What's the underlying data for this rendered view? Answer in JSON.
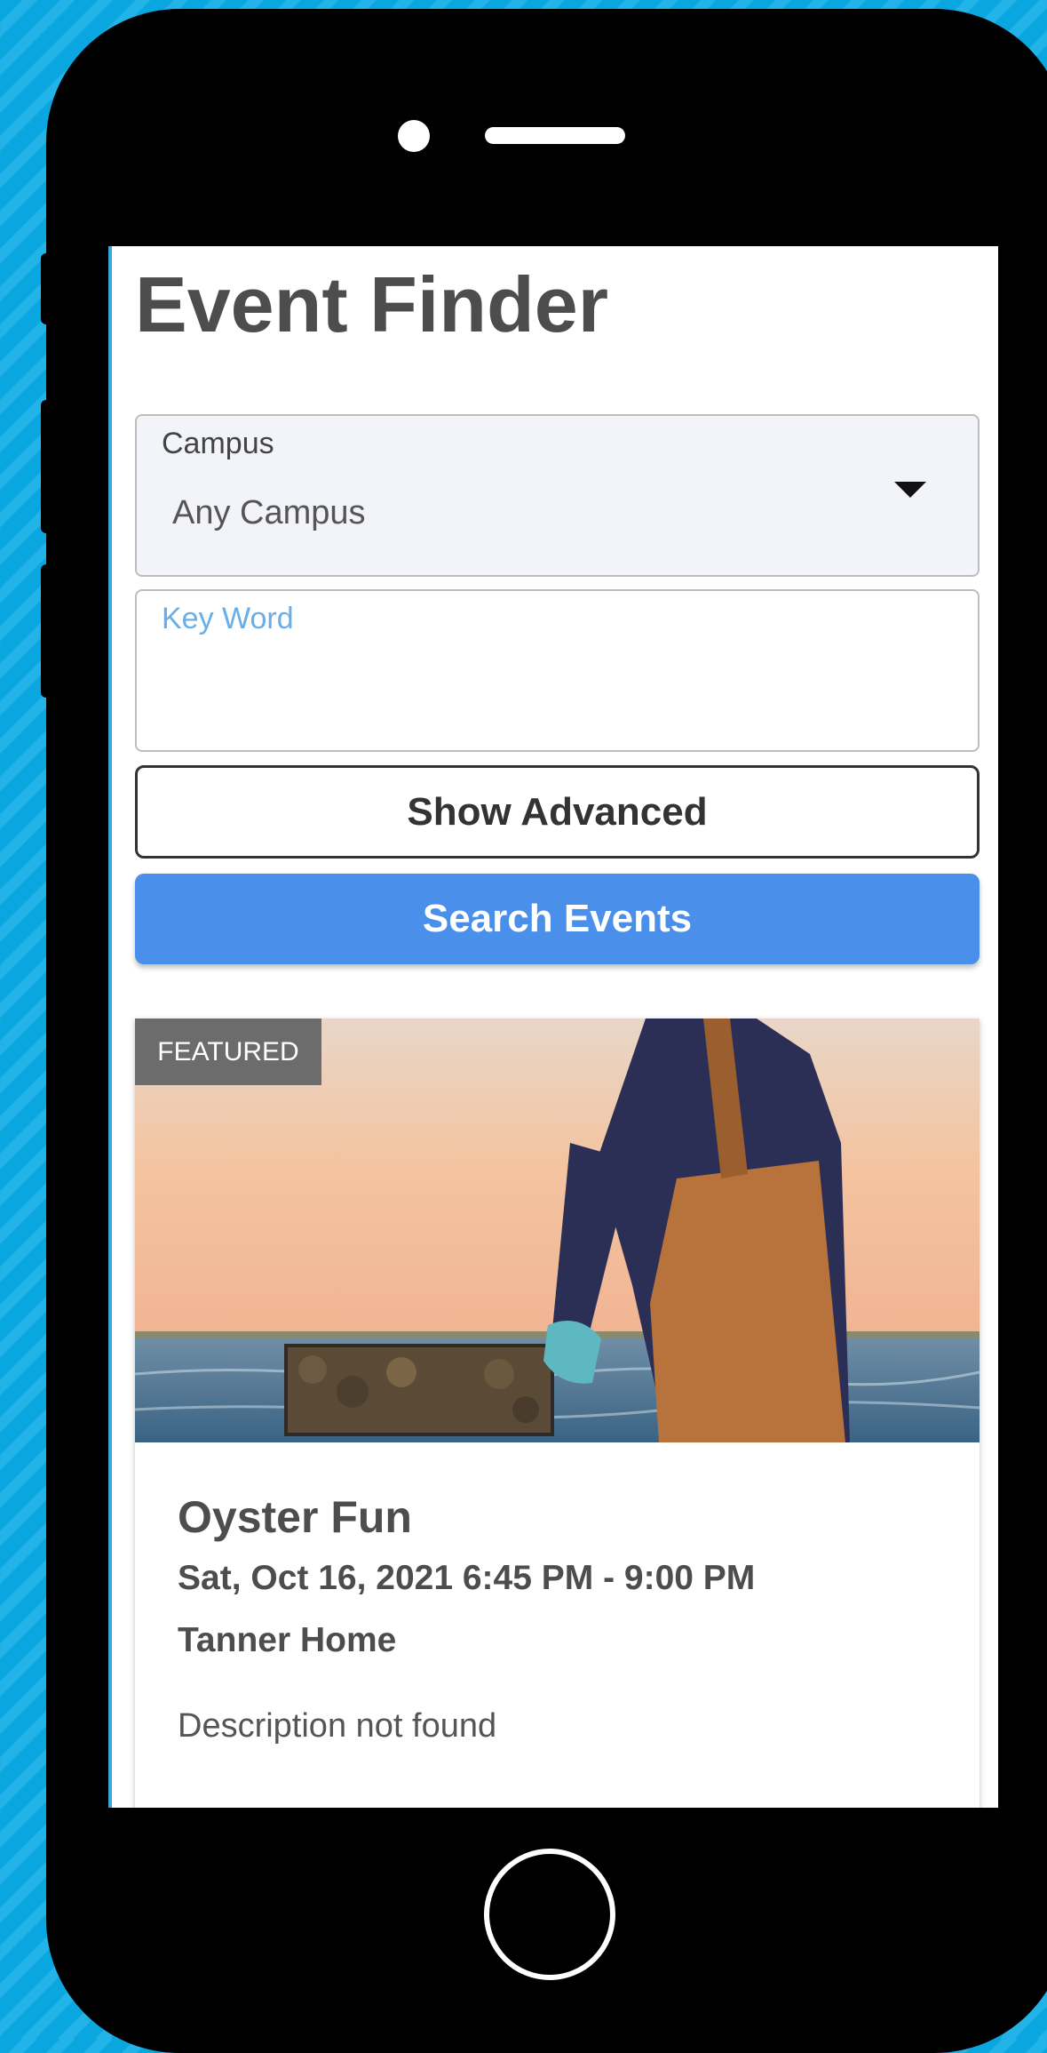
{
  "page": {
    "title": "Event Finder"
  },
  "campus": {
    "label": "Campus",
    "selected": "Any Campus"
  },
  "keyword": {
    "label": "Key Word",
    "value": ""
  },
  "buttons": {
    "show_advanced": "Show Advanced",
    "search": "Search Events"
  },
  "events": [
    {
      "badge": "FEATURED",
      "title": "Oyster Fun",
      "datetime": "Sat, Oct 16, 2021 6:45 PM - 9:00 PM",
      "location": "Tanner Home",
      "description": "Description not found"
    }
  ],
  "colors": {
    "background": "#0aa6df",
    "primary_button": "#4a8fea",
    "keyword_label": "#6aaee8",
    "badge": "#6c6c6c"
  },
  "icons": {
    "dropdown": "caret-down-icon",
    "home_button": "home-button-icon"
  }
}
